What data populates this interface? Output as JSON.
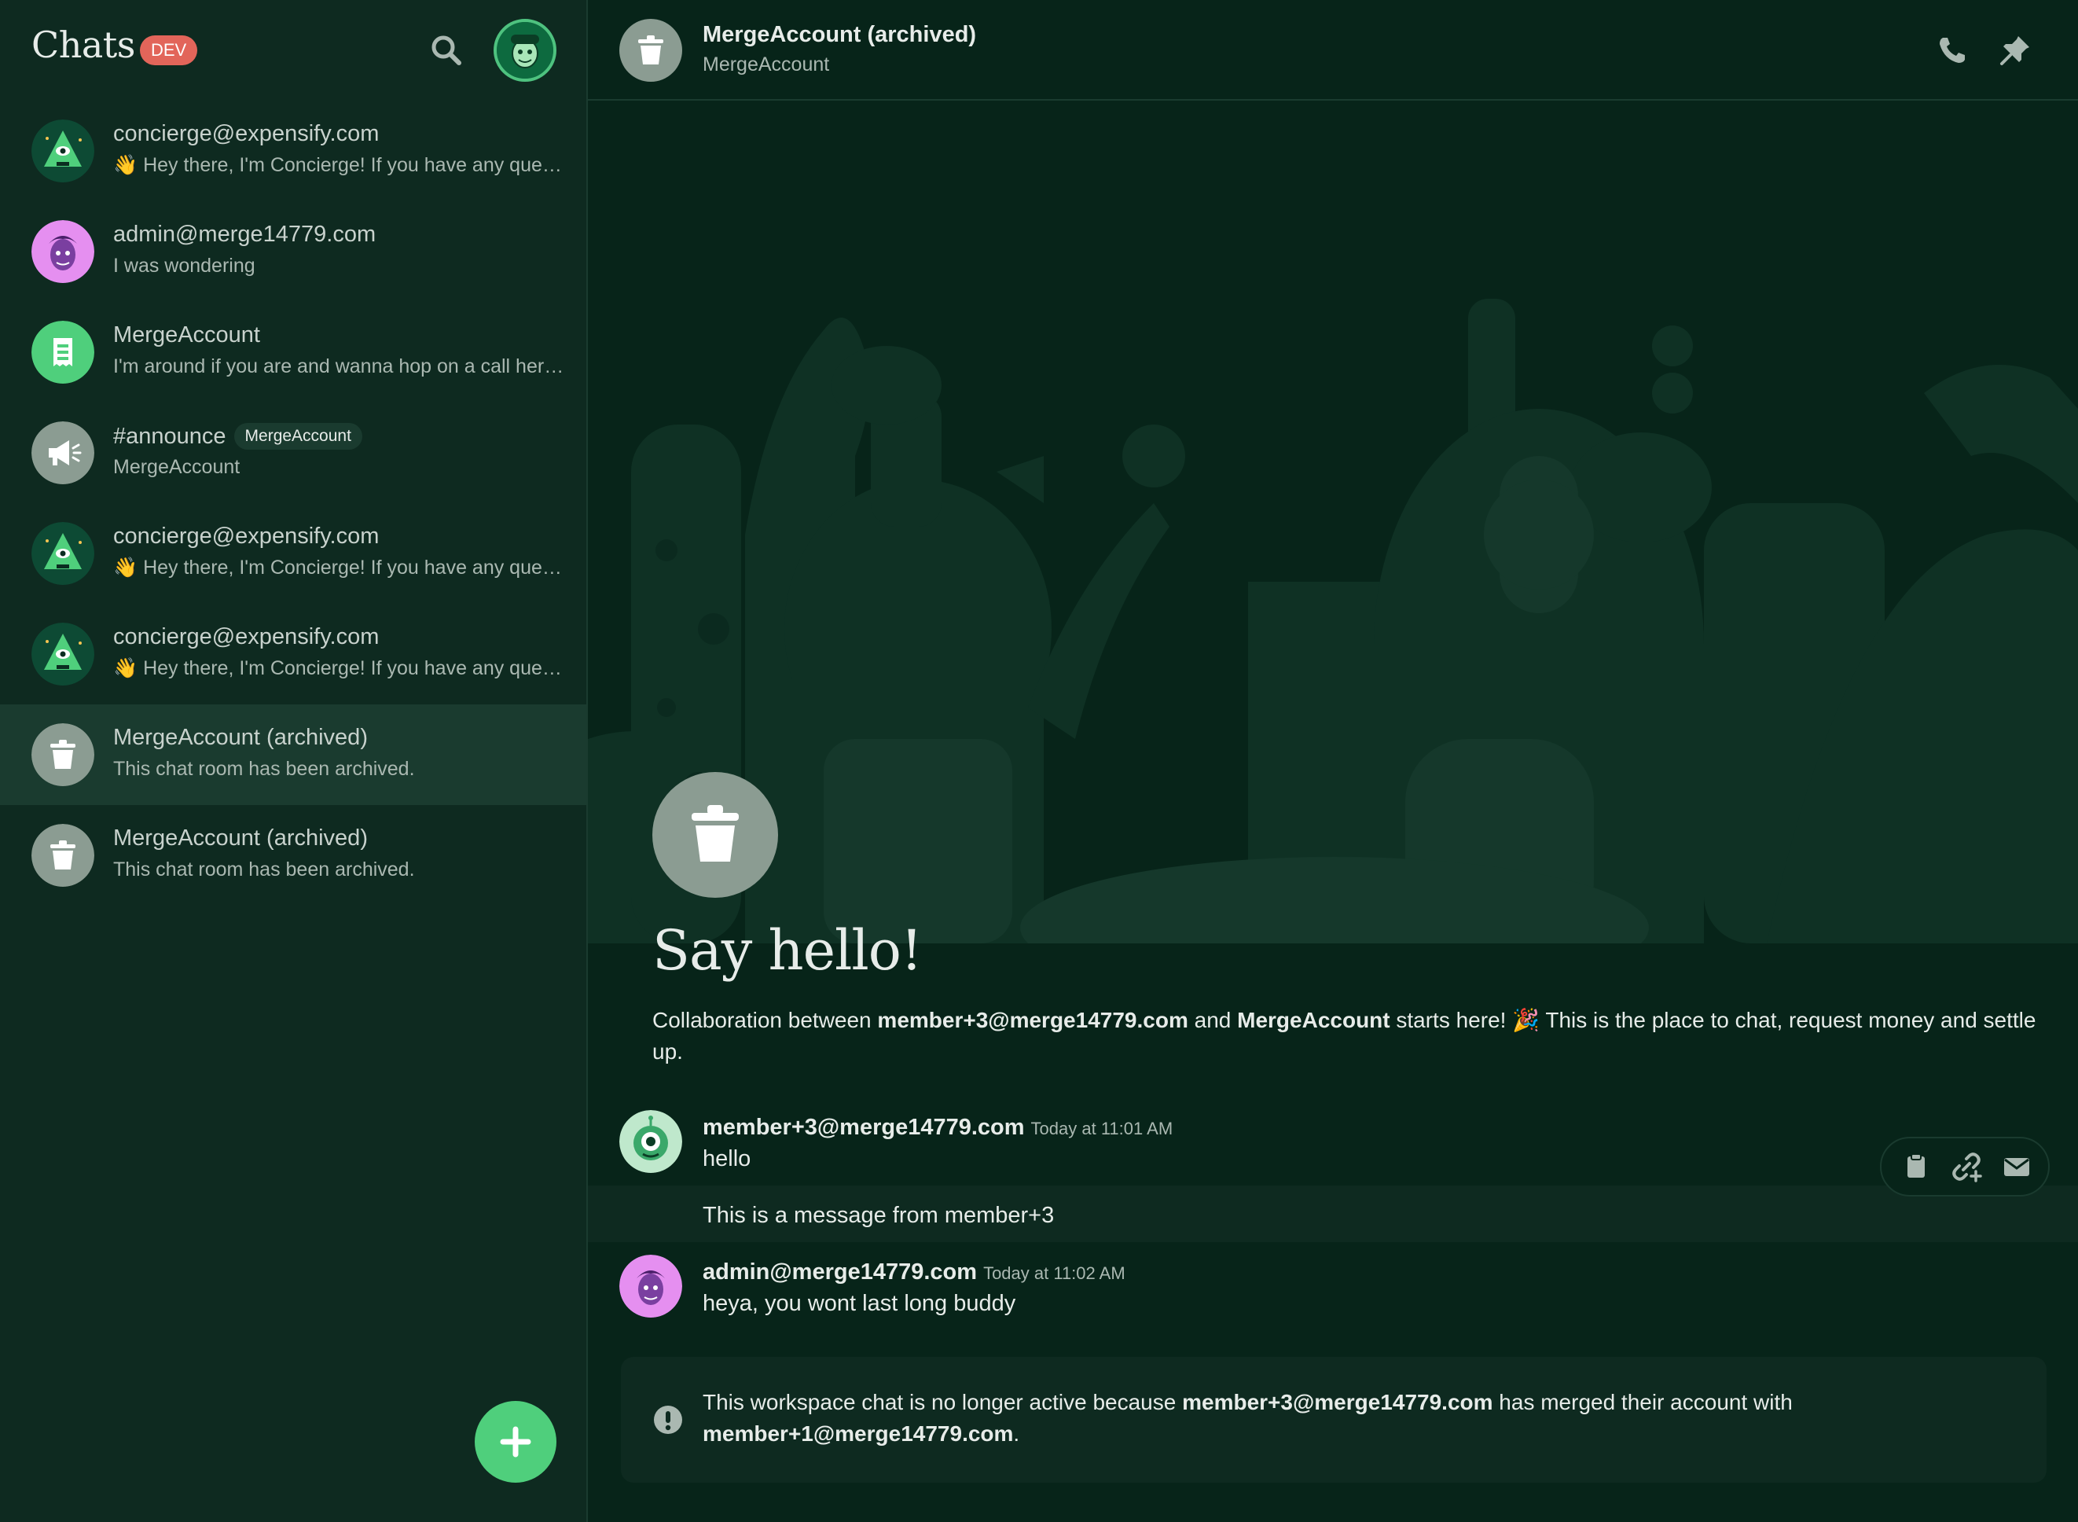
{
  "sidebar": {
    "title": "Chats",
    "badge": "DEV",
    "chats": [
      {
        "name": "concierge@expensify.com",
        "preview": "👋 Hey there, I'm Concierge! If you have any questions...",
        "avatar": "concierge-avatar-icon"
      },
      {
        "name": "admin@merge14779.com",
        "preview": "I was wondering",
        "avatar": "admin-avatar-icon"
      },
      {
        "name": "MergeAccount",
        "preview": "I'm around if you are and wanna hop on a call here...",
        "avatar": "workspace-receipt-icon"
      },
      {
        "name": "#announce",
        "tag": "MergeAccount",
        "preview": "MergeAccount",
        "avatar": "megaphone-icon"
      },
      {
        "name": "concierge@expensify.com",
        "preview": "👋 Hey there, I'm Concierge! If you have any questions...",
        "avatar": "concierge-avatar-icon"
      },
      {
        "name": "concierge@expensify.com",
        "preview": "👋 Hey there, I'm Concierge! If you have any questions...",
        "avatar": "concierge-avatar-icon"
      },
      {
        "name": "MergeAccount (archived)",
        "preview": "This chat room has been archived.",
        "avatar": "trash-icon",
        "active": true
      },
      {
        "name": "MergeAccount (archived)",
        "preview": "This chat room has been archived.",
        "avatar": "trash-icon"
      }
    ]
  },
  "header": {
    "title": "MergeAccount (archived)",
    "subtitle": "MergeAccount"
  },
  "intro": {
    "heading": "Say hello!",
    "text_before": "Collaboration between ",
    "member": "member+3@merge14779.com",
    "text_and": " and ",
    "workspace": "MergeAccount",
    "text_after": " starts here! 🎉 This is the place to chat, request money and settle up."
  },
  "messages": [
    {
      "author": "member+3@merge14779.com",
      "time": "Today at 11:01 AM",
      "lines": [
        "hello",
        "This is a message from member+3"
      ]
    },
    {
      "author": "admin@merge14779.com",
      "time": "Today at 11:02 AM",
      "lines": [
        "heya, you wont last long buddy"
      ]
    }
  ],
  "banner": {
    "text_before": "This workspace chat is no longer active because ",
    "from_account": "member+3@merge14779.com",
    "text_mid": " has merged their account with ",
    "to_account": "member+1@merge14779.com",
    "text_end": "."
  },
  "colors": {
    "background": "#072419",
    "sidebar": "#0e2a20",
    "accent_green": "#4fcf7c",
    "dev_badge": "#e2655a",
    "archived_gray": "#8b9c92"
  }
}
